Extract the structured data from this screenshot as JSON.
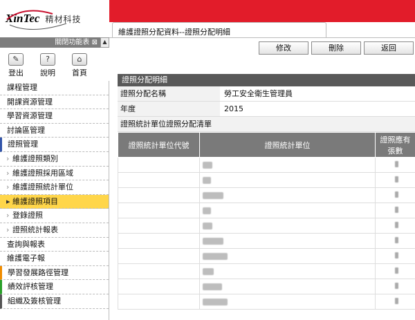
{
  "brand": {
    "logo_text": "XinTec",
    "company_cn": "精材科技",
    "accent": "#c8102e"
  },
  "menu_toggle_label": "關閉功能表",
  "quick_buttons": [
    {
      "label": "登出",
      "icon": "logout-icon"
    },
    {
      "label": "說明",
      "icon": "help-icon"
    },
    {
      "label": "首頁",
      "icon": "home-icon"
    }
  ],
  "sidebar": {
    "items": [
      {
        "label": "課程管理"
      },
      {
        "label": "開課資源管理"
      },
      {
        "label": "學習資源管理"
      },
      {
        "label": "討論區管理"
      },
      {
        "label": "證照管理"
      },
      {
        "label": "維護證照類別"
      },
      {
        "label": "維護證照採用區域"
      },
      {
        "label": "維護證照統計單位"
      },
      {
        "label": "維護證照項目"
      },
      {
        "label": "登錄證照"
      },
      {
        "label": "證照統計報表"
      },
      {
        "label": "查詢與報表"
      },
      {
        "label": "維護電子報"
      },
      {
        "label": "學習發展路徑管理"
      },
      {
        "label": "績效評核管理"
      },
      {
        "label": "組織及簽核管理"
      }
    ]
  },
  "tab": {
    "label": "維護證照分配資料--證照分配明細"
  },
  "toolbar": {
    "edit_label": "修改",
    "delete_label": "刪除",
    "back_label": "返回"
  },
  "section": {
    "title": "證照分配明細"
  },
  "fields": [
    {
      "label": "證照分配名稱",
      "value": "勞工安全衛生管理員"
    },
    {
      "label": "年度",
      "value": "2015"
    }
  ],
  "list": {
    "title": "證照統計單位證照分配清單",
    "columns": [
      "證照統計單位代號",
      "證照統計單位",
      "證照應有張數"
    ],
    "rows": [
      {},
      {},
      {},
      {},
      {},
      {},
      {},
      {},
      {},
      {}
    ]
  },
  "colors": {
    "topbar": "#e21c2a",
    "header_gray": "#595959",
    "table_head": "#7a7a7a",
    "active_item": "#ffd64a"
  }
}
